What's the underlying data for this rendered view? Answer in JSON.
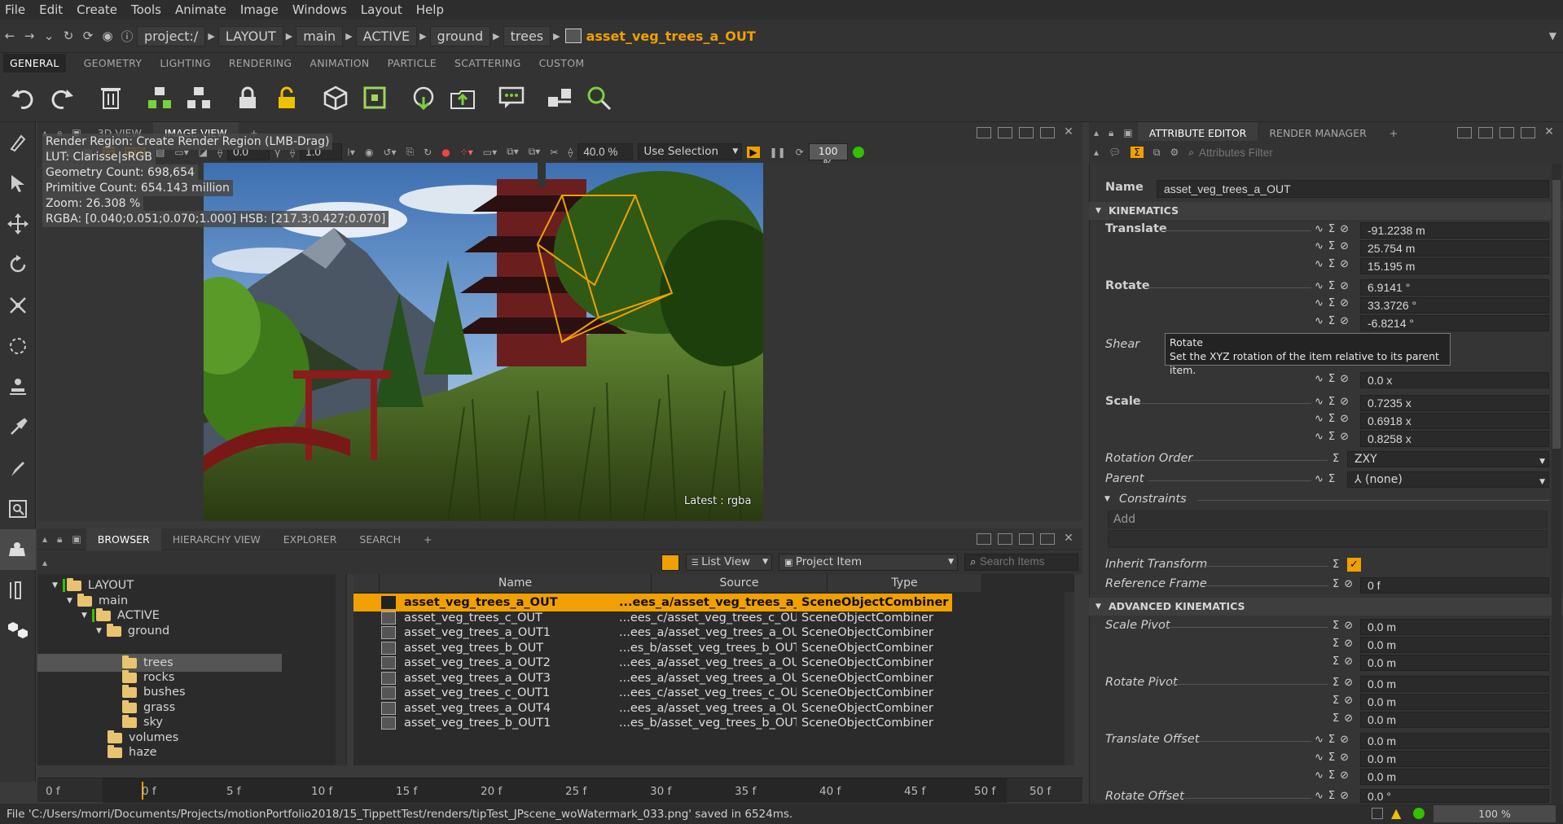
{
  "menu": [
    "File",
    "Edit",
    "Create",
    "Tools",
    "Animate",
    "Image",
    "Windows",
    "Layout",
    "Help"
  ],
  "breadcrumb": {
    "items": [
      "project:/",
      "LAYOUT",
      "main",
      "ACTIVE",
      "ground",
      "trees"
    ],
    "current": "asset_veg_trees_a_OUT"
  },
  "shelf_tabs": [
    "GENERAL",
    "GEOMETRY",
    "LIGHTING",
    "RENDERING",
    "ANIMATION",
    "PARTICLE",
    "SCATTERING",
    "CUSTOM"
  ],
  "view_tabs": [
    "3D VIEW",
    "IMAGE VIEW"
  ],
  "image_view": {
    "exposure": "0.0",
    "gamma": "1.0",
    "zoom_field": "40.0 %",
    "selection_mode": "Use Selection",
    "progress": "100 %",
    "hud": [
      "Render Region: Create Render Region (LMB-Drag)",
      "LUT: Clarisse|sRGB",
      "Geometry Count: 698,654",
      "Primitive Count: 654.143 million",
      "Zoom: 26.308 %",
      "RGBA: [0.040;0.051;0.070;1.000] HSB: [217.3;0.427;0.070]"
    ],
    "layer_label": "Latest : rgba"
  },
  "browser": {
    "tabs": [
      "BROWSER",
      "HIERARCHY VIEW",
      "EXPLORER",
      "SEARCH"
    ],
    "view_mode": "List View",
    "filter_mode": "Project Item",
    "search_placeholder": "Search Items",
    "tree": [
      "LAYOUT",
      "main",
      "ACTIVE",
      "ground",
      "trees",
      "rocks",
      "bushes",
      "grass",
      "sky",
      "volumes",
      "haze"
    ],
    "columns": [
      "Name",
      "Source",
      "Type"
    ],
    "rows": [
      {
        "name": "asset_veg_trees_a_OUT",
        "source": "...ees_a/asset_veg_trees_a_OUT",
        "type": "SceneObjectCombiner"
      },
      {
        "name": "asset_veg_trees_c_OUT",
        "source": "...ees_c/asset_veg_trees_c_OUT",
        "type": "SceneObjectCombiner"
      },
      {
        "name": "asset_veg_trees_a_OUT1",
        "source": "...ees_a/asset_veg_trees_a_OUT",
        "type": "SceneObjectCombiner"
      },
      {
        "name": "asset_veg_trees_b_OUT",
        "source": "...es_b/asset_veg_trees_b_OUT",
        "type": "SceneObjectCombiner"
      },
      {
        "name": "asset_veg_trees_a_OUT2",
        "source": "...ees_a/asset_veg_trees_a_OUT",
        "type": "SceneObjectCombiner"
      },
      {
        "name": "asset_veg_trees_a_OUT3",
        "source": "...ees_a/asset_veg_trees_a_OUT",
        "type": "SceneObjectCombiner"
      },
      {
        "name": "asset_veg_trees_c_OUT1",
        "source": "...ees_c/asset_veg_trees_c_OUT",
        "type": "SceneObjectCombiner"
      },
      {
        "name": "asset_veg_trees_a_OUT4",
        "source": "...ees_a/asset_veg_trees_a_OUT",
        "type": "SceneObjectCombiner"
      },
      {
        "name": "asset_veg_trees_b_OUT1",
        "source": "...es_b/asset_veg_trees_b_OUT",
        "type": "SceneObjectCombiner"
      }
    ]
  },
  "timeline": {
    "start": "0 f",
    "ticks": [
      "0 f",
      "5 f",
      "10 f",
      "15 f",
      "20 f",
      "25 f",
      "30 f",
      "35 f",
      "40 f",
      "45 f",
      "50 f"
    ],
    "end": "50 f"
  },
  "status": {
    "message": "File 'C:/Users/morri/Documents/Projects/motionPortfolio2018/15_TippettTest/renders/tipTest_JPscene_woWatermark_033.png' saved in 6524ms.",
    "progress": "100 %"
  },
  "attr_editor": {
    "tabs": [
      "ATTRIBUTE EDITOR",
      "RENDER MANAGER"
    ],
    "filter_placeholder": "Attributes Filter",
    "name_label": "Name",
    "name_value": "asset_veg_trees_a_OUT",
    "sections": {
      "kinematics": "KINEMATICS",
      "advanced": "ADVANCED KINEMATICS"
    },
    "translate": {
      "label": "Translate",
      "values": [
        "-91.2238 m",
        "25.754 m",
        "15.195 m"
      ]
    },
    "rotate": {
      "label": "Rotate",
      "values": [
        "6.9141 °",
        "33.3726 °",
        "-6.8214 °"
      ]
    },
    "shear": {
      "label": "Shear",
      "values": [
        "0.0 x"
      ]
    },
    "scale": {
      "label": "Scale",
      "values": [
        "0.7235 x",
        "0.6918 x",
        "0.8258 x"
      ]
    },
    "rotation_order": {
      "label": "Rotation Order",
      "value": "ZXY"
    },
    "parent": {
      "label": "Parent",
      "value": "(none)"
    },
    "constraints": {
      "label": "Constraints",
      "add": "Add"
    },
    "inherit_transform": {
      "label": "Inherit Transform",
      "checked": true
    },
    "reference_frame": {
      "label": "Reference Frame",
      "value": "0 f"
    },
    "scale_pivot": {
      "label": "Scale Pivot",
      "values": [
        "0.0 m",
        "0.0 m",
        "0.0 m"
      ]
    },
    "rotate_pivot": {
      "label": "Rotate Pivot",
      "values": [
        "0.0 m",
        "0.0 m",
        "0.0 m"
      ]
    },
    "translate_offset": {
      "label": "Translate Offset",
      "values": [
        "0.0 m",
        "0.0 m",
        "0.0 m"
      ]
    },
    "rotate_offset": {
      "label": "Rotate Offset",
      "values": [
        "0.0 °"
      ]
    },
    "tooltip": {
      "title": "Rotate",
      "text": "Set the XYZ rotation of the item relative to its parent item."
    }
  },
  "colors": {
    "accent": "#f0a000",
    "active_green": "#33c000",
    "bg": "#353535"
  }
}
